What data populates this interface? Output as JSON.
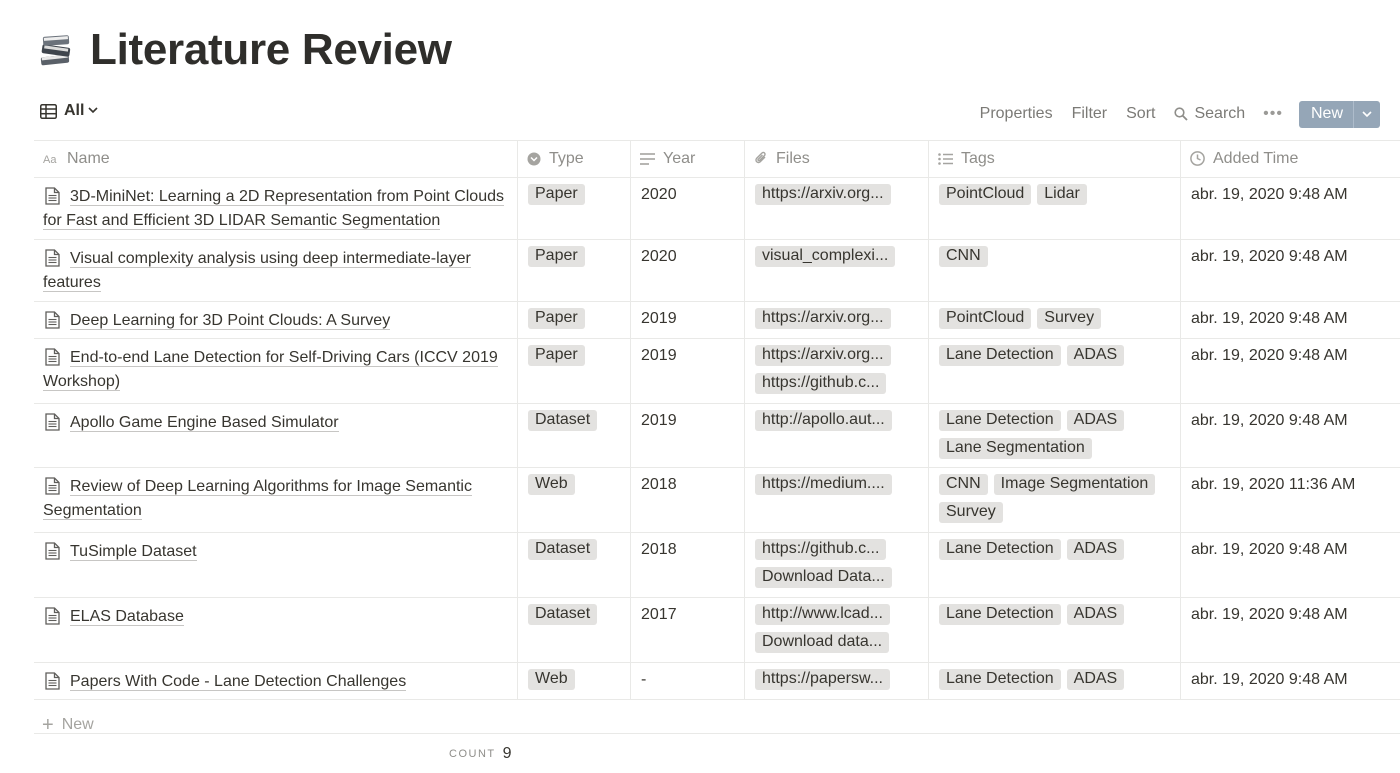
{
  "page": {
    "title": "Literature Review",
    "icon": "books-icon"
  },
  "toolbar": {
    "view_label": "All",
    "properties": "Properties",
    "filter": "Filter",
    "sort": "Sort",
    "search": "Search",
    "more": "•••",
    "new": "New"
  },
  "columns": [
    "Name",
    "Type",
    "Year",
    "Files",
    "Tags",
    "Added Time"
  ],
  "rows": [
    {
      "name": "3D-MiniNet: Learning a 2D Representation from Point Clouds for Fast and Efficient 3D LIDAR Semantic Segmentation",
      "type": "Paper",
      "year": "2020",
      "files": [
        "https://arxiv.org..."
      ],
      "tags": [
        "PointCloud",
        "Lidar"
      ],
      "added": "abr. 19, 2020 9:48 AM"
    },
    {
      "name": "Visual complexity analysis using deep intermediate-layer features",
      "type": "Paper",
      "year": "2020",
      "files": [
        "visual_complexi..."
      ],
      "tags": [
        "CNN"
      ],
      "added": "abr. 19, 2020 9:48 AM"
    },
    {
      "name": "Deep Learning for 3D Point Clouds: A Survey",
      "type": "Paper",
      "year": "2019",
      "files": [
        "https://arxiv.org..."
      ],
      "tags": [
        "PointCloud",
        "Survey"
      ],
      "added": "abr. 19, 2020 9:48 AM"
    },
    {
      "name": "End-to-end Lane Detection for Self-Driving Cars (ICCV 2019 Workshop)",
      "type": "Paper",
      "year": "2019",
      "files": [
        "https://arxiv.org...",
        "https://github.c..."
      ],
      "tags": [
        "Lane Detection",
        "ADAS"
      ],
      "added": "abr. 19, 2020 9:48 AM"
    },
    {
      "name": "Apollo Game Engine Based Simulator",
      "type": "Dataset",
      "year": "2019",
      "files": [
        "http://apollo.aut..."
      ],
      "tags": [
        "Lane Detection",
        "ADAS",
        "Lane Segmentation"
      ],
      "added": "abr. 19, 2020 9:48 AM"
    },
    {
      "name": "Review of Deep Learning Algorithms for Image Semantic Segmentation",
      "type": "Web",
      "year": "2018",
      "files": [
        "https://medium...."
      ],
      "tags": [
        "CNN",
        "Image Segmentation",
        "Survey"
      ],
      "added": "abr. 19, 2020 11:36 AM"
    },
    {
      "name": "TuSimple Dataset",
      "type": "Dataset",
      "year": "2018",
      "files": [
        "https://github.c...",
        "Download Data..."
      ],
      "tags": [
        "Lane Detection",
        "ADAS"
      ],
      "added": "abr. 19, 2020 9:48 AM"
    },
    {
      "name": "ELAS Database",
      "type": "Dataset",
      "year": "2017",
      "files": [
        "http://www.lcad...",
        "Download data..."
      ],
      "tags": [
        "Lane Detection",
        "ADAS"
      ],
      "added": "abr. 19, 2020 9:48 AM"
    },
    {
      "name": "Papers With Code - Lane Detection Challenges",
      "type": "Web",
      "year": "-",
      "files": [
        "https://papersw..."
      ],
      "tags": [
        "Lane Detection",
        "ADAS"
      ],
      "added": "abr. 19, 2020 9:48 AM"
    }
  ],
  "footer": {
    "new_label": "New",
    "count_label": "COUNT",
    "count_value": "9"
  },
  "colors": {
    "pill_bg": "#e3e2e0",
    "new_button": "#95a6b7",
    "text": "#37352f",
    "muted": "#8f8e8a"
  }
}
